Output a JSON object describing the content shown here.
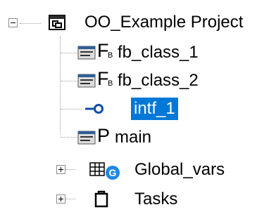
{
  "tree": {
    "root": {
      "label": "OO_Example Project",
      "expander": "minus"
    },
    "children": [
      {
        "label": "fb_class_1",
        "icon": "function-block-icon",
        "type_letter": "F",
        "type_sub": "B"
      },
      {
        "label": "fb_class_2",
        "icon": "function-block-icon",
        "type_letter": "F",
        "type_sub": "B"
      },
      {
        "label": "intf_1",
        "icon": "interface-icon",
        "selected": true
      },
      {
        "label": "main",
        "icon": "program-icon",
        "type_letter": "P"
      },
      {
        "label": "Global_vars",
        "icon": "global-variables-icon",
        "badge": "G",
        "expander": "plus"
      },
      {
        "label": "Tasks",
        "icon": "tasks-icon",
        "expander": "plus"
      }
    ]
  },
  "colors": {
    "selection": "#0078d7",
    "global_badge": "#1e88e5",
    "interface_icon": "#0a4fa8",
    "pou_icon_header": "#2f5f9a"
  }
}
